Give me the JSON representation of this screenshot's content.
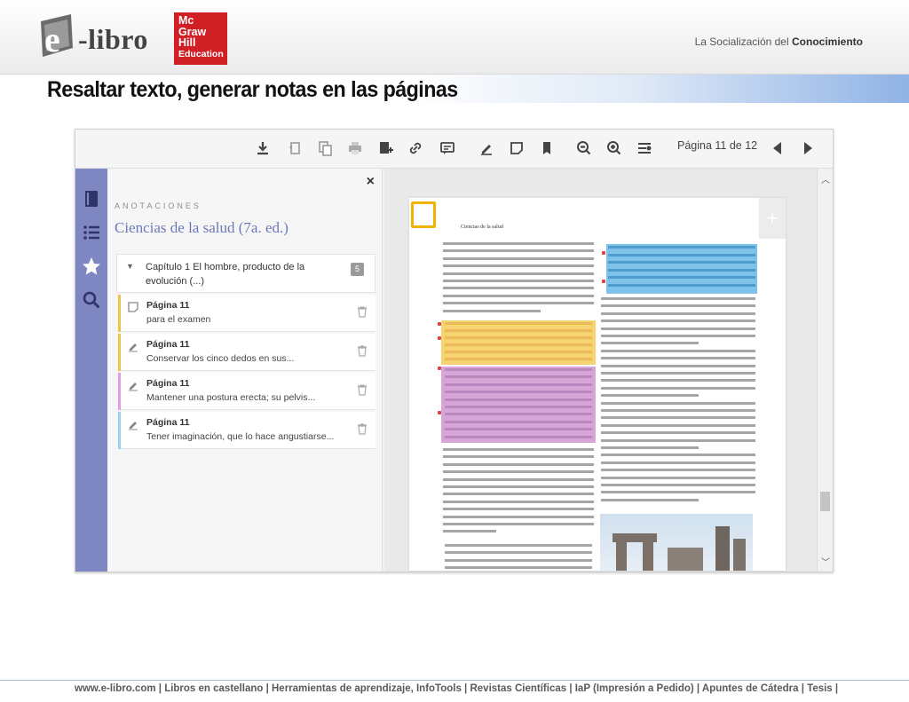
{
  "header": {
    "logo_prefix": "e",
    "logo_text": "-libro",
    "publisher_logo": [
      "Mc",
      "Graw",
      "Hill",
      "Education"
    ],
    "tagline_prefix": "La Socialización del",
    "tagline_bold": "Conocimiento"
  },
  "slide_title": "Resaltar texto, generar notas en las páginas",
  "app": {
    "toolbar": {
      "icons": [
        "download-icon",
        "undo-icon",
        "copy-icon",
        "print-icon",
        "add-page-icon",
        "link-icon",
        "comment-icon",
        "highlight-icon",
        "note-icon",
        "bookmark-icon",
        "zoom-out-icon",
        "zoom-in-icon",
        "settings-list-icon"
      ],
      "page_label": "Página 11 de 12",
      "prev_icon": "triangle-left-icon",
      "next_icon": "triangle-right-icon"
    },
    "rail": {
      "icons": [
        "book-icon",
        "list-icon",
        "star-icon",
        "search-icon"
      ]
    },
    "panel": {
      "close": "×",
      "heading": "ANOTACIONES",
      "book_title": "Ciencias de la salud (7a. ed.)",
      "chapter": {
        "caret": "▼",
        "title": "Capítulo 1 El hombre, producto de la evolución (...)",
        "count": "5"
      },
      "notes": [
        {
          "page": "Página 11",
          "text": "para el examen",
          "icon": "note-icon",
          "color": "#f0c24a"
        },
        {
          "page": "Página 11",
          "text": "Conservar los cinco dedos en sus...",
          "icon": "highlighter-icon",
          "color": "#f0c24a"
        },
        {
          "page": "Página 11",
          "text": "Mantener una postura erecta; su pelvis...",
          "icon": "highlighter-icon",
          "color": "#e59be0"
        },
        {
          "page": "Página 11",
          "text": "Tener imaginación, que lo hace angustiarse...",
          "icon": "highlighter-icon",
          "color": "#9ad0ef"
        }
      ]
    },
    "viewer": {
      "page_header": "Ciencias de la salud",
      "plus": "+"
    }
  },
  "footer": "www.e-libro.com | Libros en castellano | Herramientas de aprendizaje, InfoTools | Revistas Científicas | IaP (Impresión a Pedido) | Apuntes de Cátedra | Tesis |"
}
